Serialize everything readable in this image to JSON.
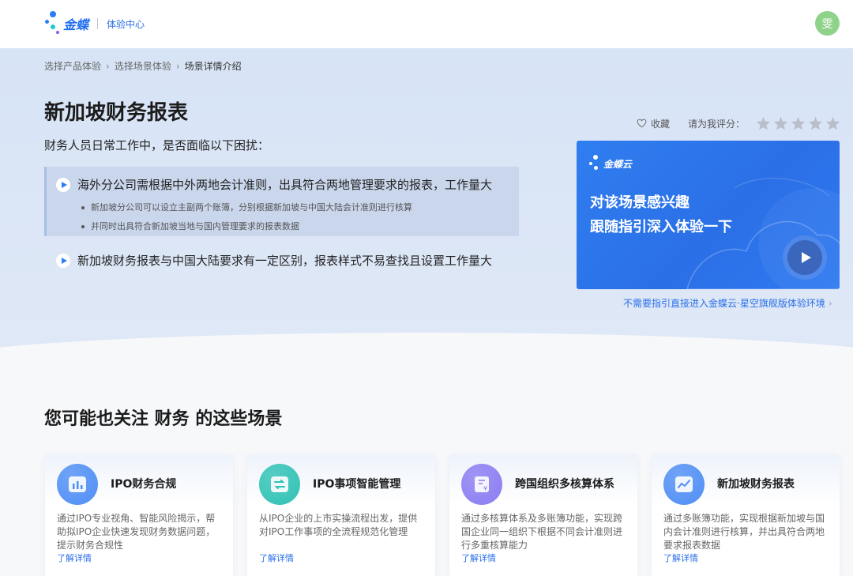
{
  "header": {
    "brand": "金蝶",
    "subtitle": "体验中心",
    "avatar_text": "雯"
  },
  "breadcrumb": [
    "选择产品体验",
    "选择场景体验",
    "场景详情介绍"
  ],
  "page": {
    "title": "新加坡财务报表",
    "intro": "财务人员日常工作中，是否面临以下困扰："
  },
  "issues": [
    {
      "title": "海外分公司需根据中外两地会计准则，出具符合两地管理要求的报表，工作量大",
      "bullets": [
        "新加坡分公司可以设立主副两个账簿，分别根据新加坡与中国大陆会计准则进行核算",
        "并同时出具符合新加坡当地与国内管理要求的报表数据"
      ]
    },
    {
      "title": "新加坡财务报表与中国大陆要求有一定区别，报表样式不易查找且设置工作量大",
      "bullets": []
    }
  ],
  "actions": {
    "favorite_label": "收藏",
    "rate_label": "请为我评分：",
    "rating": 0,
    "max_rating": 5
  },
  "video_card": {
    "logo_text": "金蝶云",
    "line1": "对该场景感兴趣",
    "line2": "跟随指引深入体验一下"
  },
  "direct_link": "不需要指引直接进入金蝶云·星空旗舰版体验环境",
  "related": {
    "title": "您可能也关注 财务 的这些场景",
    "cards": [
      {
        "title": "IPO财务合规",
        "desc": "通过IPO专业视角、智能风险揭示，帮助拟IPO企业快速发现财务数据问题，提示财务合规性",
        "link": "了解详情",
        "icon": "chart-report-icon",
        "color": "#4f8ef5"
      },
      {
        "title": "IPO事项智能管理",
        "desc": "从IPO企业的上市实操流程出发，提供对IPO工作事项的全流程规范化管理",
        "link": "了解详情",
        "icon": "workflow-icon",
        "color": "#2fc2b5"
      },
      {
        "title": "跨国组织多核算体系",
        "desc": "通过多核算体系及多账簿功能，实现跨国企业同一组织下根据不同会计准则进行多重核算能力",
        "link": "了解详情",
        "icon": "ledger-yen-icon",
        "color": "#8a7cf2"
      },
      {
        "title": "新加坡财务报表",
        "desc": "通过多账簿功能，实现根据新加坡与国内会计准则进行核算，并出具符合两地要求报表数据",
        "link": "了解详情",
        "icon": "line-chart-icon",
        "color": "#4f8ef5"
      }
    ]
  }
}
